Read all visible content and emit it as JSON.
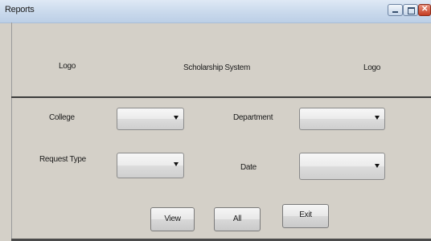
{
  "window": {
    "title": "Reports"
  },
  "header": {
    "left_logo": "Logo",
    "center_title": "Scholarship System",
    "right_logo": "Logo"
  },
  "form": {
    "college_label": "College",
    "department_label": "Department",
    "request_type_label": "Request Type",
    "date_label": "Date",
    "college_value": "",
    "department_value": "",
    "request_type_value": "",
    "date_value": ""
  },
  "buttons": {
    "view": "View",
    "all": "All",
    "exit": "Exit"
  },
  "icons": {
    "minimize": "minimize-icon",
    "maximize": "maximize-icon",
    "close": "close-icon",
    "dropdown": "chevron-down-icon"
  },
  "colors": {
    "background": "#d4d0c8",
    "close_button": "#c63c22",
    "titlebar": "#c9d9ec"
  }
}
